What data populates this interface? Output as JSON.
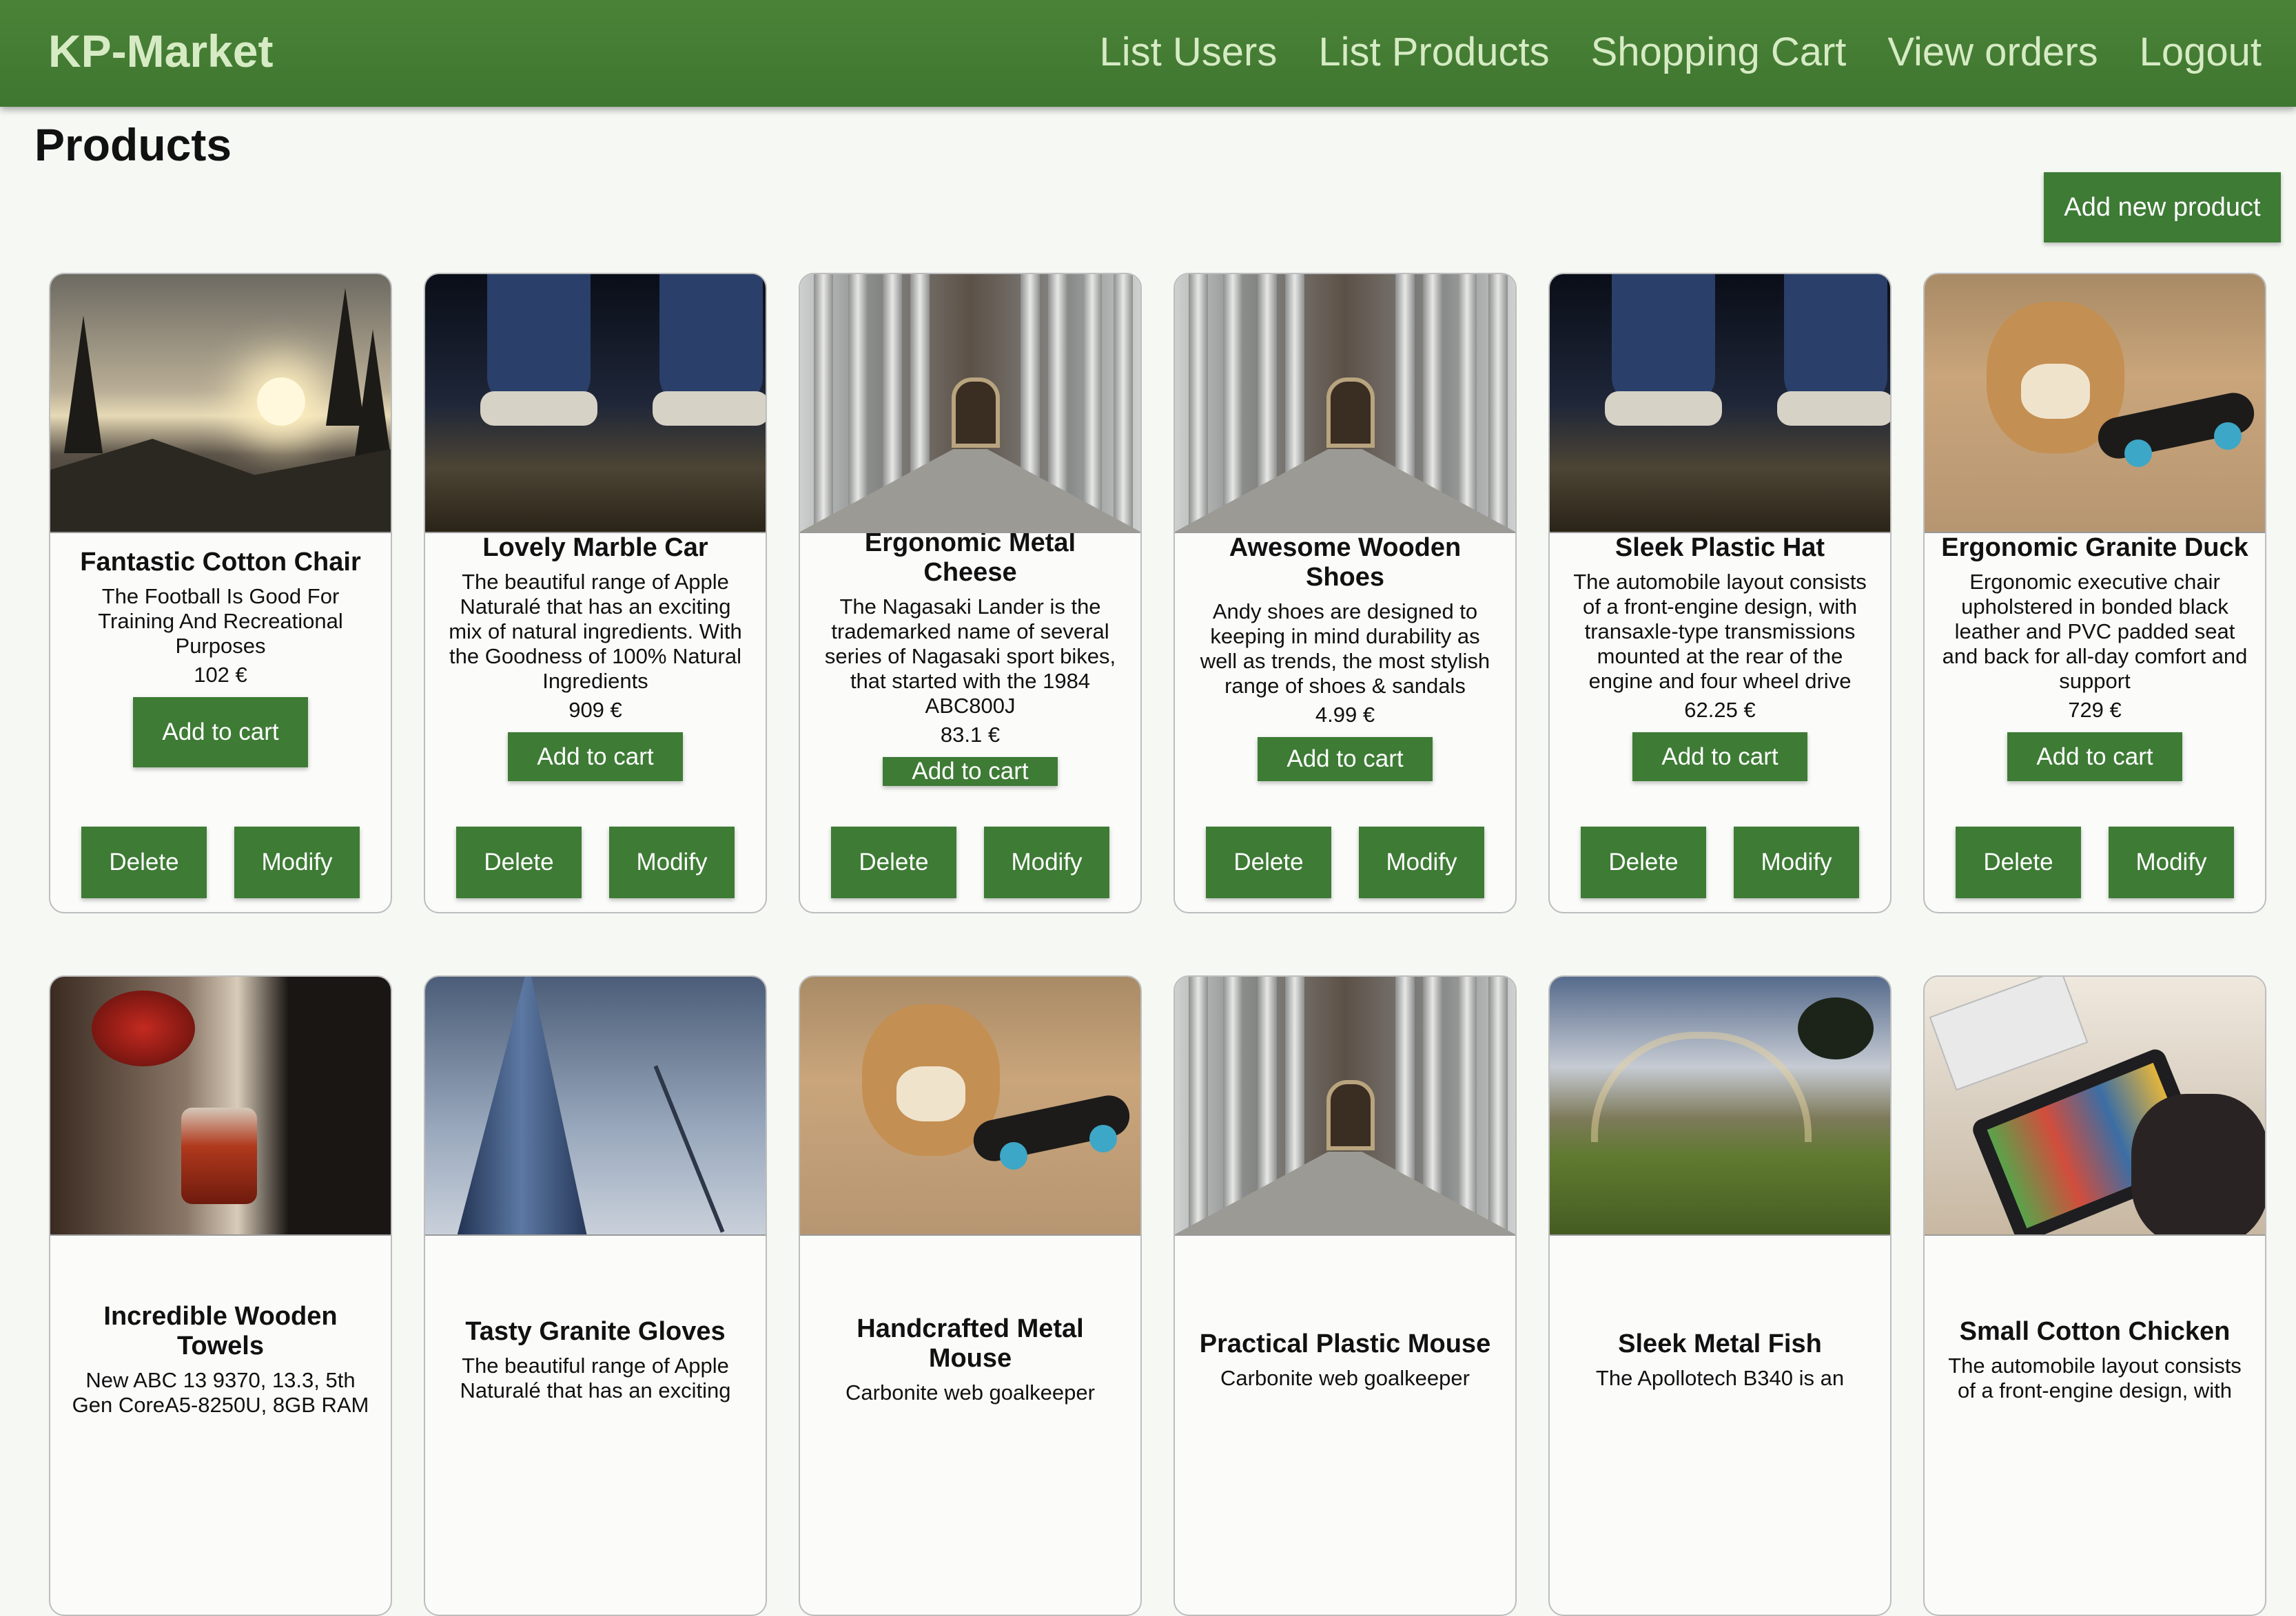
{
  "brand": "KP-Market",
  "nav": [
    "List Users",
    "List Products",
    "Shopping Cart",
    "View orders",
    "Logout"
  ],
  "page_title": "Products",
  "add_new_label": "Add new product",
  "labels": {
    "add_to_cart": "Add to cart",
    "delete": "Delete",
    "modify": "Modify"
  },
  "products": [
    {
      "name": "Fantastic Cotton Chair",
      "description": "The Football Is Good For Training And Recreational Purposes",
      "price": "102 €",
      "image": "sunset-forest"
    },
    {
      "name": "Lovely Marble Car",
      "description": "The beautiful range of Apple Naturalé that has an exciting mix of natural ingredients. With the Goodness of 100% Natural Ingredients",
      "price": "909 €",
      "image": "feet-jeans"
    },
    {
      "name": "Ergonomic Metal Cheese",
      "description": "The Nagasaki Lander is the trademarked name of several series of Nagasaki sport bikes, that started with the 1984 ABC800J",
      "price": "83.1 €",
      "image": "column-corridor"
    },
    {
      "name": "Awesome Wooden Shoes",
      "description": "Andy shoes are designed to keeping in mind durability as well as trends, the most stylish range of shoes & sandals",
      "price": "4.99 €",
      "image": "column-corridor"
    },
    {
      "name": "Sleek Plastic Hat",
      "description": "The automobile layout consists of a front-engine design, with transaxle-type transmissions mounted at the rear of the engine and four wheel drive",
      "price": "62.25 €",
      "image": "feet-jeans"
    },
    {
      "name": "Ergonomic Granite Duck",
      "description": "Ergonomic executive chair upholstered in bonded black leather and PVC padded seat and back for all-day comfort and support",
      "price": "729 €",
      "image": "puppy-skateboard"
    },
    {
      "name": "Incredible Wooden Towels",
      "description": "New ABC 13 9370, 13.3, 5th Gen CoreA5-8250U, 8GB RAM",
      "price": "",
      "image": "tea-pour"
    },
    {
      "name": "Tasty Granite Gloves",
      "description": "The beautiful range of Apple Naturalé that has an exciting",
      "price": "",
      "image": "glass-tower"
    },
    {
      "name": "Handcrafted Metal Mouse",
      "description": "Carbonite web goalkeeper",
      "price": "",
      "image": "puppy-skateboard"
    },
    {
      "name": "Practical Plastic Mouse",
      "description": "Carbonite web goalkeeper",
      "price": "",
      "image": "column-corridor"
    },
    {
      "name": "Sleek Metal Fish",
      "description": "The Apollotech B340 is an",
      "price": "",
      "image": "golf-rainbow"
    },
    {
      "name": "Small Cotton Chicken",
      "description": "The automobile layout consists of a front-engine design, with",
      "price": "",
      "image": "ipad-hands"
    }
  ]
}
